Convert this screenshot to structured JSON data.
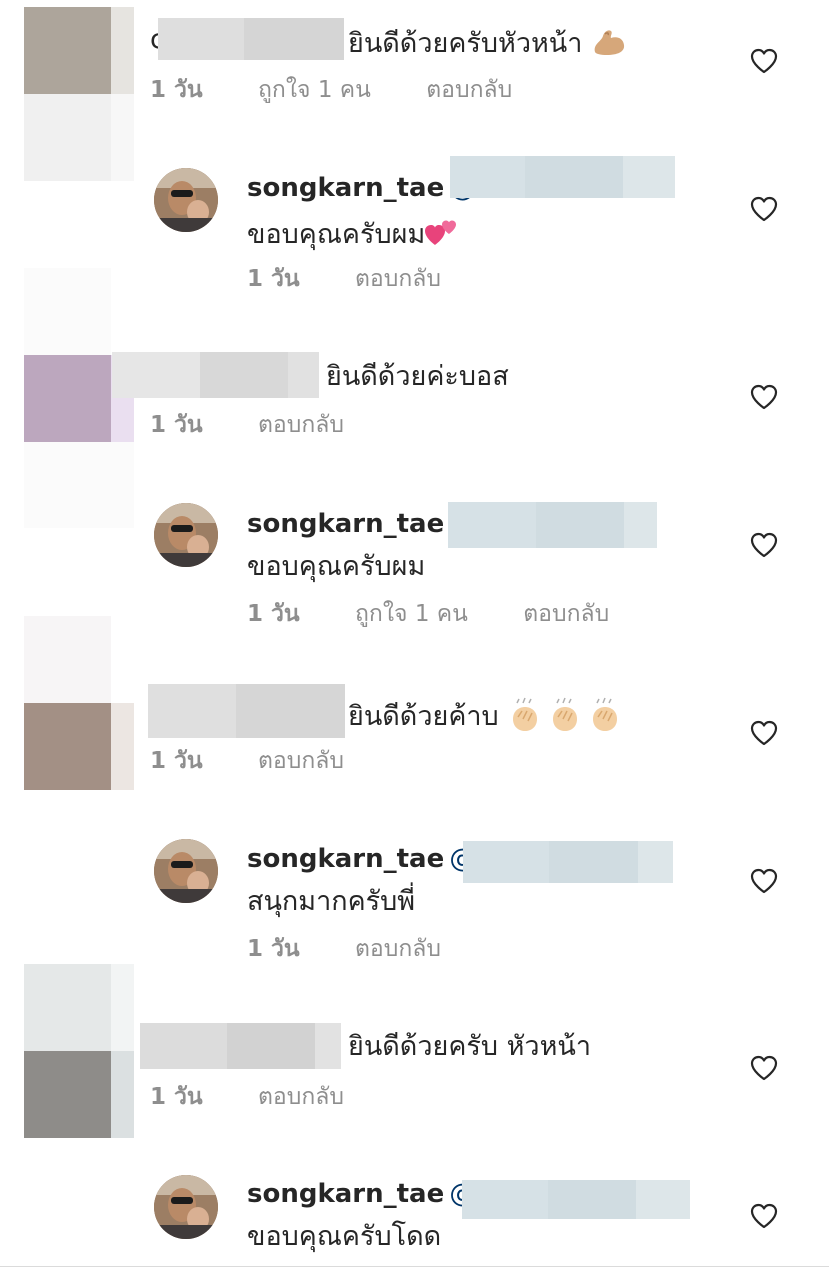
{
  "comments": [
    {
      "prefix": "c",
      "text": "ยินดีด้วยครับหัวหน้า",
      "emoji": "flexed-biceps",
      "time": "1 วัน",
      "likes": "ถูกใจ 1 คน",
      "reply": "ตอบกลับ"
    },
    {
      "username": "songkarn_tae",
      "mention": "@",
      "text": "ขอบคุณครับผม",
      "emoji": "two-hearts",
      "time": "1 วัน",
      "reply": "ตอบกลับ"
    },
    {
      "text": "ยินดีด้วยค่ะบอส",
      "time": "1 วัน",
      "reply": "ตอบกลับ"
    },
    {
      "username": "songkarn_tae",
      "mention": "",
      "text": "ขอบคุณครับผม",
      "time": "1 วัน",
      "likes": "ถูกใจ 1 คน",
      "reply": "ตอบกลับ"
    },
    {
      "text": "ยินดีด้วยค้าบ",
      "emoji": "clapping-hands",
      "time": "1 วัน",
      "reply": "ตอบกลับ"
    },
    {
      "username": "songkarn_tae",
      "mention": "@",
      "text": "สนุกมากครับพี่",
      "time": "1 วัน",
      "reply": "ตอบกลับ"
    },
    {
      "text": "ยินดีด้วยครับ หัวหน้า",
      "time": "1 วัน",
      "reply": "ตอบกลับ"
    },
    {
      "username": "songkarn_tae",
      "mention": "@",
      "text": "ขอบคุณครับโดด"
    }
  ],
  "colors": {
    "text": "#262626",
    "meta": "#8e8e8e",
    "mention": "#003569",
    "heart": "#262626",
    "blur_gray": "#d9d9d9",
    "blur_blue": "#d3dde2"
  }
}
